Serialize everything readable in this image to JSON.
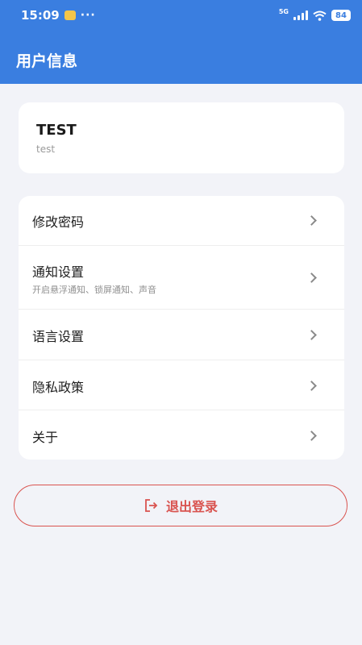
{
  "status_bar": {
    "time": "15:09",
    "dots": "···",
    "network": "5G",
    "battery": "84"
  },
  "header": {
    "title": "用户信息"
  },
  "user": {
    "name": "TEST",
    "username": "test"
  },
  "menu": {
    "items": [
      {
        "label": "修改密码",
        "sub": ""
      },
      {
        "label": "通知设置",
        "sub": "开启悬浮通知、锁屏通知、声音"
      },
      {
        "label": "语言设置",
        "sub": ""
      },
      {
        "label": "隐私政策",
        "sub": ""
      },
      {
        "label": "关于",
        "sub": ""
      }
    ]
  },
  "logout": {
    "label": "退出登录",
    "icon": "logout-icon"
  },
  "colors": {
    "header": "#3a7ee0",
    "background": "#f2f3f8",
    "danger": "#d9534f"
  }
}
